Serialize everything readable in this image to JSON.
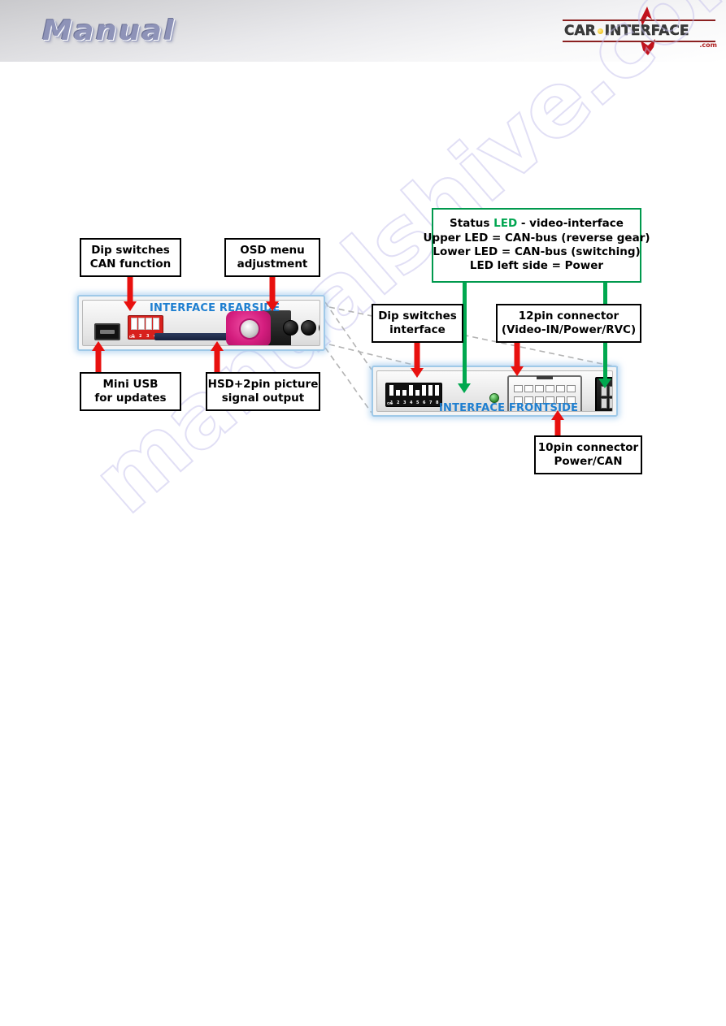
{
  "header": {
    "title": "Manual",
    "logo": {
      "part1": "CAR",
      "part2": "INTERFACE",
      "tld": ".com",
      "dot_icon": "yellow-dot-icon",
      "swoosh_icon": "red-swoosh-icon",
      "brand_red": "#c1121c",
      "brand_dark": "#3a3a3a"
    }
  },
  "watermark": {
    "text": "manualshive.com",
    "color": "#b9b4e6"
  },
  "callouts": {
    "dip_switches_can": {
      "line1": "Dip switches",
      "line2": "CAN function"
    },
    "osd_menu": {
      "line1": "OSD menu",
      "line2": "adjustment"
    },
    "mini_usb": {
      "line1": "Mini USB",
      "line2": "for updates"
    },
    "hsd_output": {
      "line1": "HSD+2pin picture",
      "line2": "signal output"
    },
    "dip_switches_interface": {
      "line1": "Dip switches",
      "line2": "interface"
    },
    "connector_12pin": {
      "line1": "12pin connector",
      "line2": "(Video-IN/Power/RVC)"
    },
    "connector_10pin": {
      "line1": "10pin connector",
      "line2": "Power/CAN"
    },
    "status_led": {
      "title_a": "Status ",
      "title_led": "LED",
      "title_b": " - video-interface",
      "line2": "Upper LED = CAN-bus (reverse gear)",
      "line3": "Lower LED = CAN-bus (switching)",
      "line4": "LED left side = Power",
      "border_color": "#00994d",
      "accent_color": "#00a550"
    }
  },
  "devices": {
    "rearside": {
      "caption": "INTERFACE REARSIDE",
      "caption_color": "#1f7fd0",
      "dip_switch_labels": [
        "1",
        "2",
        "3",
        "4"
      ],
      "dip_on_label": "ON",
      "parts": [
        "mini-usb-port",
        "dip-switch-block-4",
        "hsd-connector",
        "button-1",
        "button-2",
        "button-3"
      ]
    },
    "frontside": {
      "caption": "INTERFACE FRONTSIDE",
      "caption_color": "#1f7fd0",
      "dip_switch_labels": [
        "1",
        "2",
        "3",
        "4",
        "5",
        "6",
        "7",
        "8"
      ],
      "dip_on_label": "ON",
      "parts": [
        "dip-switch-block-8",
        "power-led",
        "12pin-connector",
        "10pin-connector",
        "led-upper",
        "led-lower"
      ]
    }
  },
  "arrows": {
    "red_color": "#e8110f",
    "green_color": "#00a84f"
  }
}
